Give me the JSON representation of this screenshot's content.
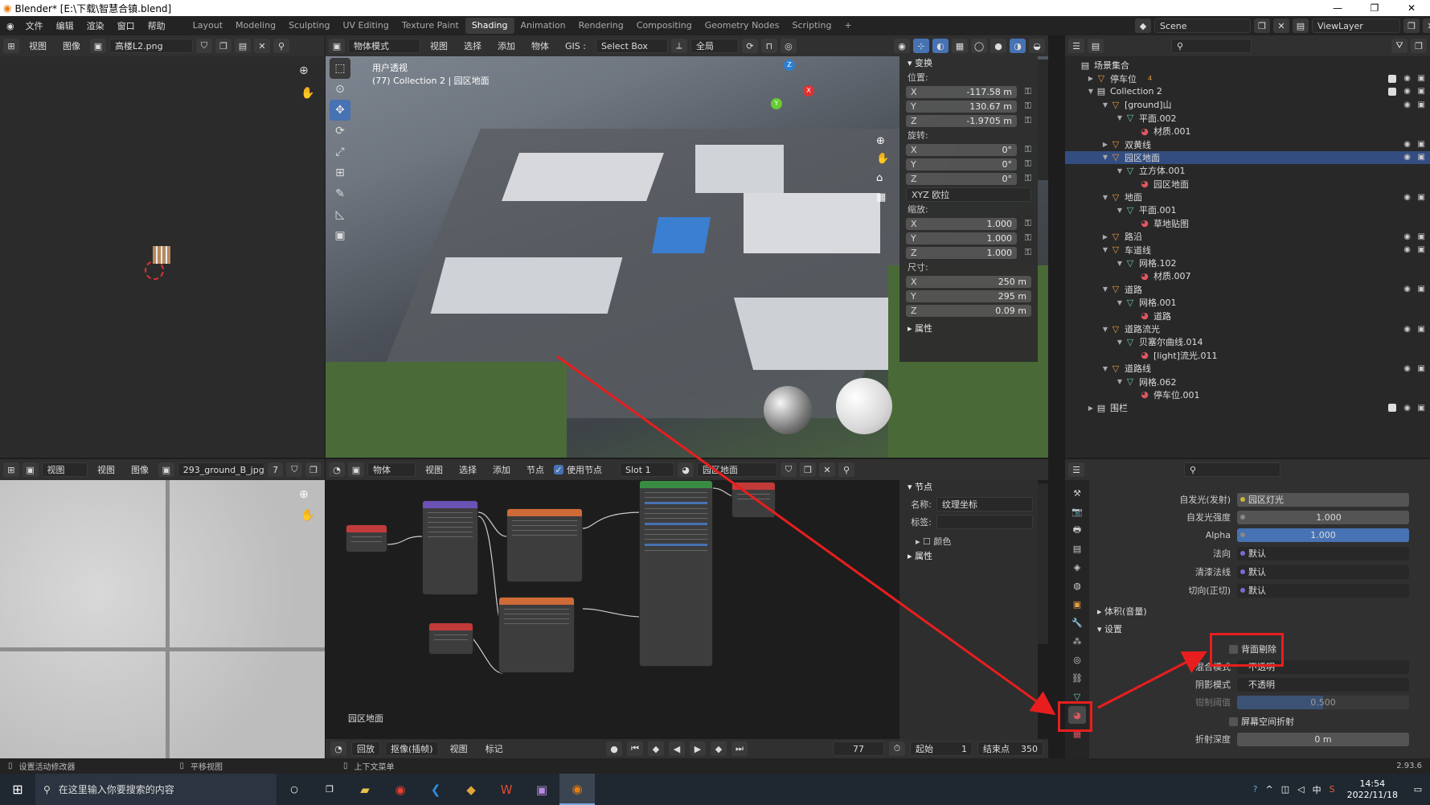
{
  "title": "Blender* [E:\\下载\\智慧合镇.blend]",
  "menus": [
    "文件",
    "编辑",
    "渲染",
    "窗口",
    "帮助"
  ],
  "workspaces": [
    "Layout",
    "Modeling",
    "Sculpting",
    "UV Editing",
    "Texture Paint",
    "Shading",
    "Animation",
    "Rendering",
    "Compositing",
    "Geometry Nodes",
    "Scripting"
  ],
  "active_workspace": "Shading",
  "scene": "Scene",
  "view_layer": "ViewLayer",
  "image_editor_top": {
    "menus": [
      "视图",
      "图像"
    ],
    "image": "高楼L2.png"
  },
  "viewport_header": {
    "mode": "物体模式",
    "menus": [
      "视图",
      "选择",
      "添加",
      "物体",
      "GIS :"
    ],
    "select_box": "Select Box",
    "transform": "全局"
  },
  "viewport_overlay": {
    "line1": "用户透视",
    "line2": "(77) Collection 2 | 园区地面"
  },
  "transform_panel": {
    "title": "变换",
    "location_label": "位置:",
    "location": {
      "x": "-117.58 m",
      "y": "130.67 m",
      "z": "-1.9705 m"
    },
    "rotation_label": "旋转:",
    "rotation": {
      "x": "0°",
      "y": "0°",
      "z": "0°"
    },
    "rotation_mode": "XYZ 欧拉",
    "scale_label": "缩放:",
    "scale": {
      "x": "1.000",
      "y": "1.000",
      "z": "1.000"
    },
    "dimensions_label": "尺寸:",
    "dimensions": {
      "x": "250 m",
      "y": "295 m",
      "z": "0.09 m"
    },
    "properties": "属性"
  },
  "axis_labels": {
    "x": "X",
    "y": "Y",
    "z": "Z"
  },
  "outliner": {
    "root": "场景集合",
    "rows": [
      {
        "name": "停车位",
        "depth": 1,
        "type": "obj",
        "expanded": false,
        "badge": "4"
      },
      {
        "name": "Collection 2",
        "depth": 1,
        "type": "coll",
        "expanded": true
      },
      {
        "name": "[ground]山",
        "depth": 2,
        "type": "obj",
        "expanded": true
      },
      {
        "name": "平面.002",
        "depth": 3,
        "type": "mesh",
        "expanded": true
      },
      {
        "name": "材质.001",
        "depth": 4,
        "type": "mat"
      },
      {
        "name": "双黄线",
        "depth": 2,
        "type": "obj",
        "expanded": false
      },
      {
        "name": "园区地面",
        "depth": 2,
        "type": "obj",
        "expanded": true,
        "selected": true
      },
      {
        "name": "立方体.001",
        "depth": 3,
        "type": "mesh",
        "expanded": true
      },
      {
        "name": "园区地面",
        "depth": 4,
        "type": "mat"
      },
      {
        "name": "地面",
        "depth": 2,
        "type": "obj",
        "expanded": true
      },
      {
        "name": "平面.001",
        "depth": 3,
        "type": "mesh",
        "expanded": true
      },
      {
        "name": "草地贴图",
        "depth": 4,
        "type": "mat"
      },
      {
        "name": "路沿",
        "depth": 2,
        "type": "obj",
        "expanded": false
      },
      {
        "name": "车道线",
        "depth": 2,
        "type": "obj",
        "expanded": true
      },
      {
        "name": "网格.102",
        "depth": 3,
        "type": "mesh",
        "expanded": true
      },
      {
        "name": "材质.007",
        "depth": 4,
        "type": "mat"
      },
      {
        "name": "道路",
        "depth": 2,
        "type": "obj",
        "expanded": true
      },
      {
        "name": "网格.001",
        "depth": 3,
        "type": "mesh",
        "expanded": true
      },
      {
        "name": "道路",
        "depth": 4,
        "type": "mat"
      },
      {
        "name": "道路流光",
        "depth": 2,
        "type": "obj",
        "expanded": true
      },
      {
        "name": "贝塞尔曲线.014",
        "depth": 3,
        "type": "mesh",
        "expanded": true
      },
      {
        "name": "[light]流光.011",
        "depth": 4,
        "type": "mat"
      },
      {
        "name": "道路线",
        "depth": 2,
        "type": "obj",
        "expanded": true
      },
      {
        "name": "网格.062",
        "depth": 3,
        "type": "mesh",
        "expanded": true
      },
      {
        "name": "停车位.001",
        "depth": 4,
        "type": "mat"
      },
      {
        "name": "围栏",
        "depth": 1,
        "type": "coll",
        "expanded": false
      }
    ]
  },
  "image_editor_bottom": {
    "menus": [
      "视图",
      "视图",
      "图像"
    ],
    "image": "293_ground_B_jpg",
    "users": "7"
  },
  "node_editor_header": {
    "object": "物体",
    "menus": [
      "视图",
      "选择",
      "添加",
      "节点"
    ],
    "use_nodes": "使用节点",
    "slot": "Slot 1",
    "material": "园区地面"
  },
  "node_editor_label": "园区地面",
  "node_panel": {
    "title": "节点",
    "name_label": "名称:",
    "name_value": "纹理坐标",
    "tag_label": "标签:",
    "tag_value": "",
    "color": "颜色",
    "properties": "属性"
  },
  "material_props": {
    "emission_label": "自发光(发射)",
    "emission_value": "园区灯光",
    "emission_strength_label": "自发光强度",
    "emission_strength": "1.000",
    "alpha_label": "Alpha",
    "alpha": "1.000",
    "normal_label": "法向",
    "normal_value": "默认",
    "clearcoat_normal_label": "清漆法线",
    "clearcoat_normal_value": "默认",
    "tangent_label": "切向(正切)",
    "tangent_value": "默认",
    "volume_section": "体积(音量)",
    "settings_section": "设置",
    "backface_culling": "背面剔除",
    "blend_mode_label": "混合模式",
    "blend_mode": "不透明",
    "shadow_mode_label": "阴影模式",
    "shadow_mode": "不透明",
    "clip_threshold_label": "钳制阈值",
    "clip_threshold": "0.500",
    "ssr_label": "屏幕空间折射",
    "refraction_depth_label": "折射深度",
    "refraction_depth": "0 m"
  },
  "timeline": {
    "playback": "回放",
    "keying": "抠像(插帧)",
    "menus": [
      "视图",
      "标记"
    ],
    "current_frame": "77",
    "start_label": "起始",
    "start": "1",
    "end_label": "结束点",
    "end": "350"
  },
  "statusbar": {
    "left": "设置活动修改器",
    "mid": "平移视图",
    "right_hint": "上下文菜单",
    "version": "2.93.6"
  },
  "taskbar": {
    "search_placeholder": "在这里输入你要搜索的内容",
    "time": "14:54",
    "date": "2022/11/18",
    "ime": "中"
  },
  "colors": {
    "accent": "#4772b3",
    "selected_row": "#334d80",
    "highlight": "#e81e1e"
  }
}
